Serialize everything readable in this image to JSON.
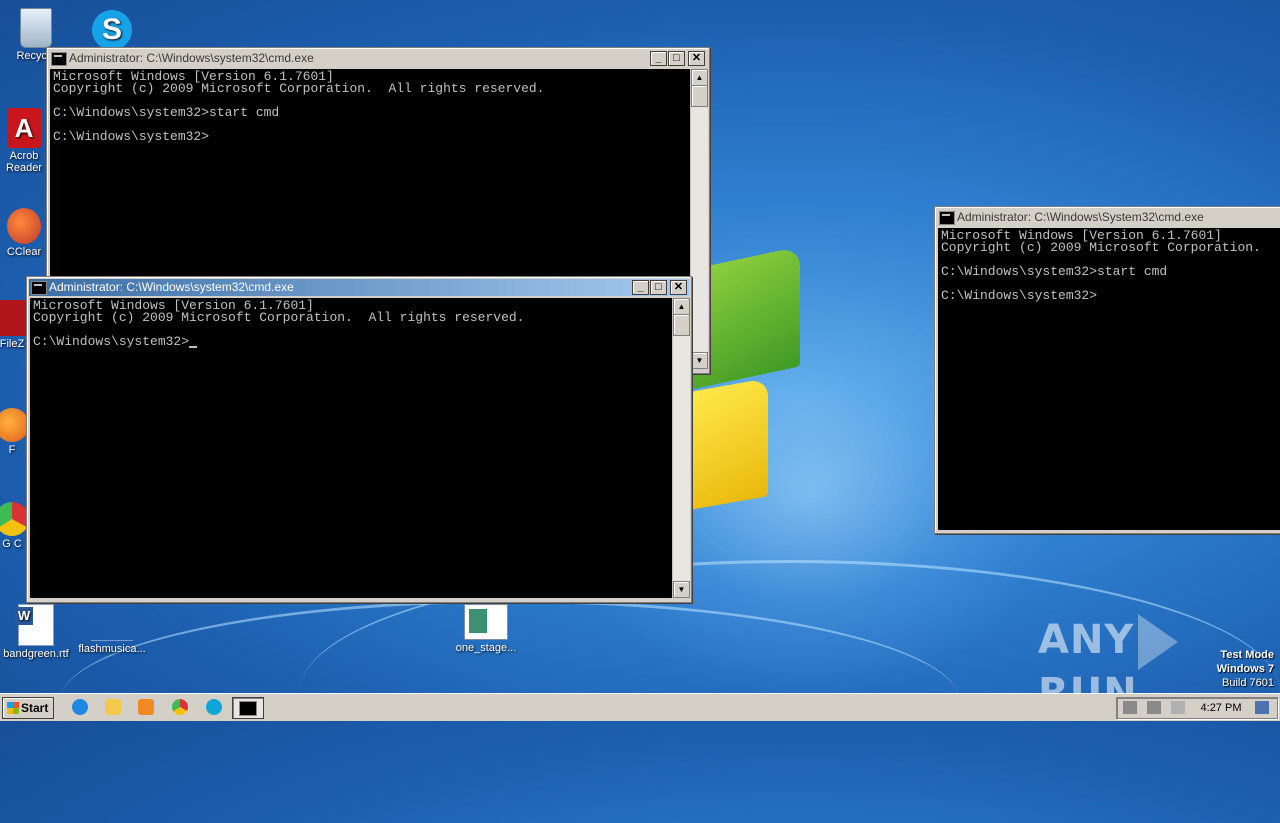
{
  "desktop": {
    "icons": [
      {
        "label": "Recycle",
        "icon": "recycle-bin-icon"
      },
      {
        "label": "",
        "icon": "skype-icon"
      },
      {
        "label": "Acrob Reader",
        "icon": "acrobat-reader-icon"
      },
      {
        "label": "CClear",
        "icon": "ccleaner-icon"
      },
      {
        "label": "FileZ",
        "icon": "filezilla-icon"
      },
      {
        "label": "F",
        "icon": "firefox-icon"
      },
      {
        "label": "G C",
        "icon": "chrome-icon"
      },
      {
        "label": "bandgreen.rtf",
        "icon": "word-document-icon"
      },
      {
        "label": "flashmusica...",
        "icon": "file-icon"
      },
      {
        "label": "one_stage...",
        "icon": "image-document-icon"
      }
    ]
  },
  "windows": {
    "back": {
      "title": "Administrator: C:\\Windows\\system32\\cmd.exe",
      "lines": [
        "Microsoft Windows [Version 6.1.7601]",
        "Copyright (c) 2009 Microsoft Corporation.  All rights reserved.",
        "",
        "C:\\Windows\\system32>start cmd",
        "",
        "C:\\Windows\\system32>"
      ]
    },
    "front": {
      "title": "Administrator: C:\\Windows\\system32\\cmd.exe",
      "lines": [
        "Microsoft Windows [Version 6.1.7601]",
        "Copyright (c) 2009 Microsoft Corporation.  All rights reserved.",
        "",
        "C:\\Windows\\system32>"
      ]
    },
    "right": {
      "title": "Administrator: C:\\Windows\\System32\\cmd.exe",
      "lines": [
        "Microsoft Windows [Version 6.1.7601]",
        "Copyright (c) 2009 Microsoft Corporation.",
        "",
        "C:\\Windows\\system32>start cmd",
        "",
        "C:\\Windows\\system32>"
      ]
    },
    "buttons": {
      "minimize": "_",
      "maximize": "□",
      "close": "✕"
    }
  },
  "watermark": {
    "left": "ANY",
    "right": "RUN"
  },
  "testmode": {
    "line1": "Test Mode",
    "line2": "Windows 7",
    "line3": "Build 7601"
  },
  "taskbar": {
    "start_label": "Start",
    "clock": "4:27 PM",
    "colors": {
      "ie": "#1e88e5",
      "explorer": "#f2c94c",
      "media": "#f08a24",
      "chrome": "#db3236",
      "edge": "#0fa5d8"
    }
  }
}
